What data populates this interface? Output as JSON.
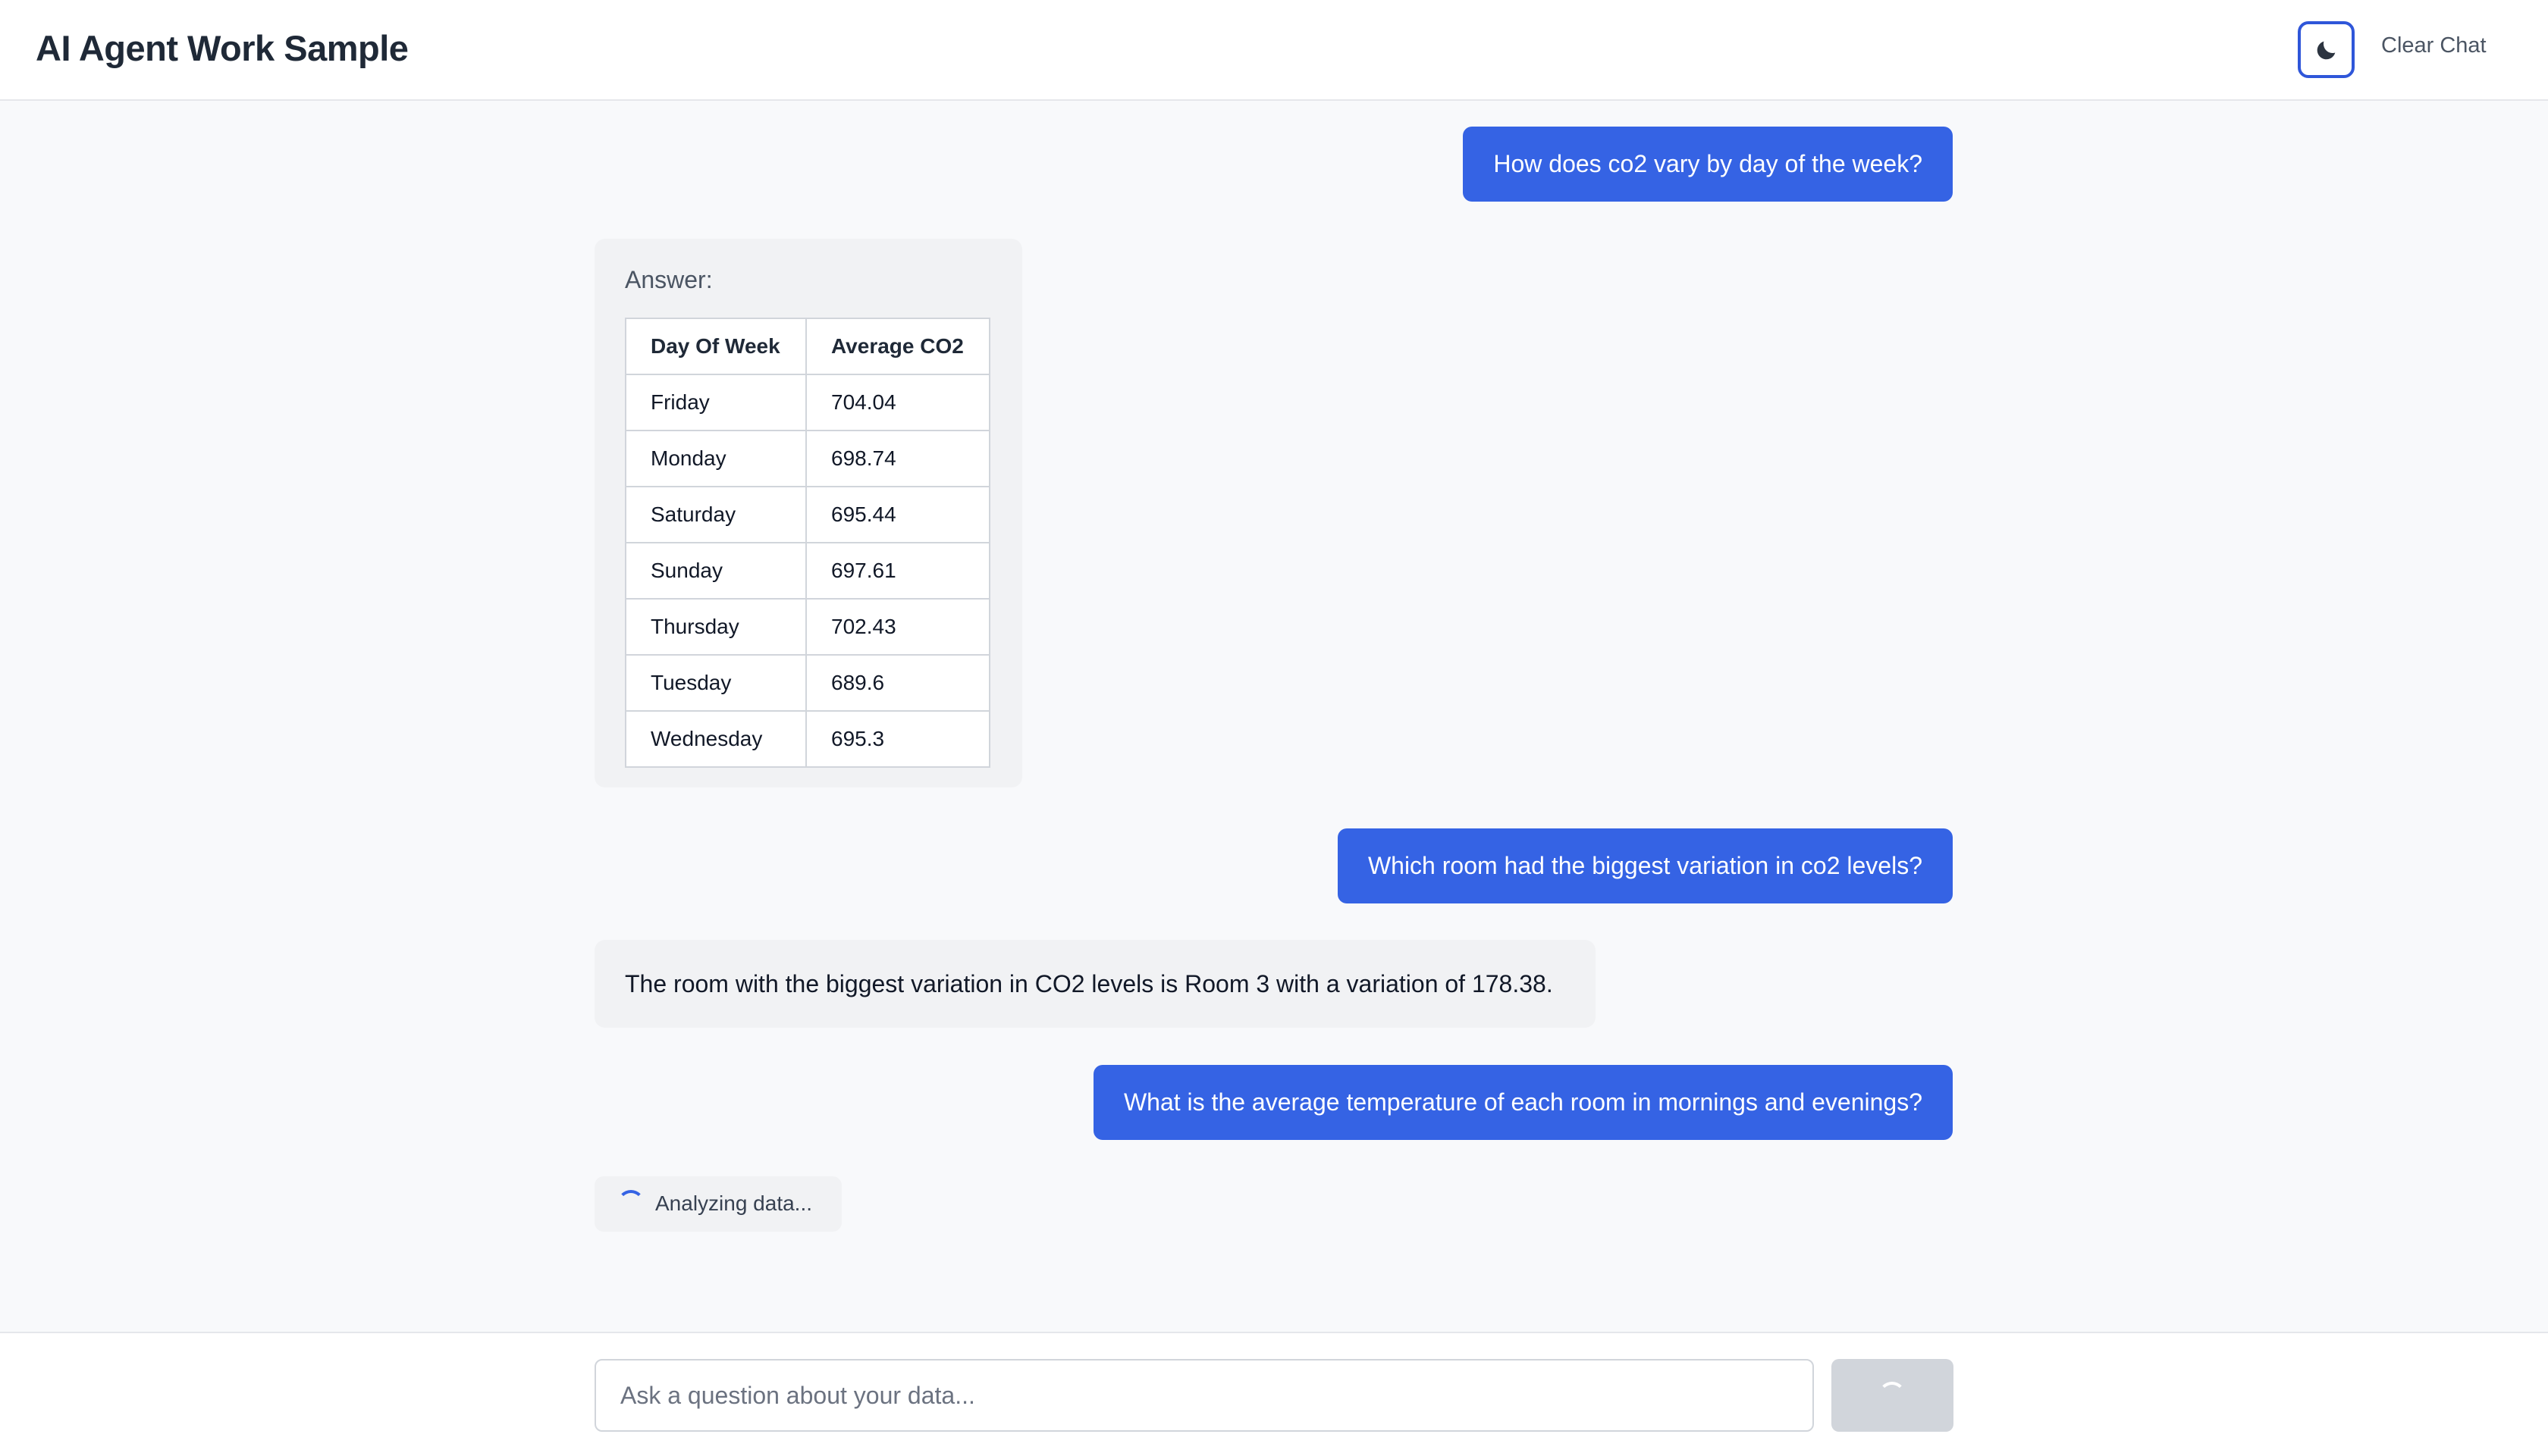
{
  "header": {
    "title": "AI Agent Work Sample",
    "theme_toggle_icon": "moon-icon",
    "clear_chat_label": "Clear Chat"
  },
  "messages": [
    {
      "role": "user",
      "text": "How does co2 vary by day of the week?"
    },
    {
      "role": "assistant",
      "label": "Answer:",
      "table": {
        "columns": [
          "Day Of Week",
          "Average CO2"
        ],
        "rows": [
          [
            "Friday",
            "704.04"
          ],
          [
            "Monday",
            "698.74"
          ],
          [
            "Saturday",
            "695.44"
          ],
          [
            "Sunday",
            "697.61"
          ],
          [
            "Thursday",
            "702.43"
          ],
          [
            "Tuesday",
            "689.6"
          ],
          [
            "Wednesday",
            "695.3"
          ]
        ]
      }
    },
    {
      "role": "user",
      "text": "Which room had the biggest variation in co2 levels?"
    },
    {
      "role": "assistant",
      "text": "The room with the biggest variation in CO2 levels is Room 3 with a variation of 178.38."
    },
    {
      "role": "user",
      "text": "What is the average temperature of each room in mornings and evenings?"
    }
  ],
  "loading": {
    "text": "Analyzing data..."
  },
  "input": {
    "placeholder": "Ask a question about your data...",
    "value": ""
  },
  "colors": {
    "accent": "#3563e4",
    "user_bubble": "#3563e4",
    "assistant_bubble": "#f1f2f4",
    "send_disabled": "#d1d5db"
  }
}
